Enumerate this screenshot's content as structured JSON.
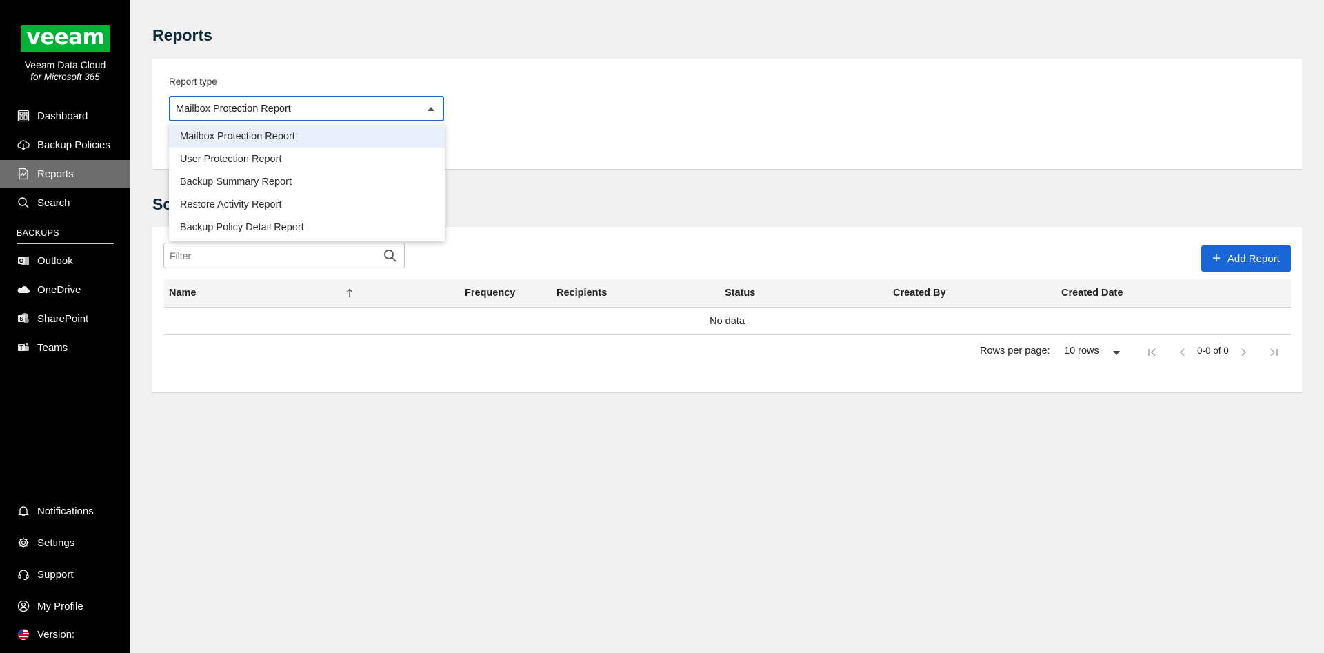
{
  "sidebar": {
    "logo": "veeam",
    "product_name": "Veeam Data Cloud",
    "product_sub": "for Microsoft 365",
    "nav": [
      {
        "label": "Dashboard",
        "icon": "dashboard-icon"
      },
      {
        "label": "Backup Policies",
        "icon": "cloud-backup-icon"
      },
      {
        "label": "Reports",
        "icon": "reports-icon",
        "active": true
      },
      {
        "label": "Search",
        "icon": "search-icon"
      }
    ],
    "backups_label": "BACKUPS",
    "backups": [
      {
        "label": "Outlook",
        "icon": "outlook-icon"
      },
      {
        "label": "OneDrive",
        "icon": "onedrive-icon"
      },
      {
        "label": "SharePoint",
        "icon": "sharepoint-icon"
      },
      {
        "label": "Teams",
        "icon": "teams-icon"
      }
    ],
    "bottom": [
      {
        "label": "Notifications",
        "icon": "bell-icon"
      },
      {
        "label": "Settings",
        "icon": "gear-icon"
      },
      {
        "label": "Support",
        "icon": "headset-icon"
      },
      {
        "label": "My Profile",
        "icon": "profile-icon"
      },
      {
        "label": "Version:",
        "icon": "us-flag-icon"
      }
    ]
  },
  "page": {
    "title": "Reports",
    "report_type_label": "Report type",
    "report_type_value": "Mailbox Protection Report",
    "section_heading_partial": "Sc",
    "dropdown_options": [
      "Mailbox Protection Report",
      "User Protection Report",
      "Backup Summary Report",
      "Restore Activity Report",
      "Backup Policy Detail Report"
    ],
    "selected_option_index": 0
  },
  "table": {
    "filter_placeholder": "Filter",
    "add_button": "Add Report",
    "columns": [
      "Name",
      "Frequency",
      "Recipients",
      "Status",
      "Created By",
      "Created Date"
    ],
    "empty_text": "No data",
    "rows_per_page_label": "Rows per page:",
    "rows_per_page_value": "10 rows",
    "range_text": "0-0 of 0"
  },
  "colors": {
    "sidebar_bg": "#000000",
    "active_nav_bg": "#6e6e6e",
    "brand_green": "#00b336",
    "accent_blue": "#1a66d6",
    "page_bg": "#f0f0f0"
  }
}
